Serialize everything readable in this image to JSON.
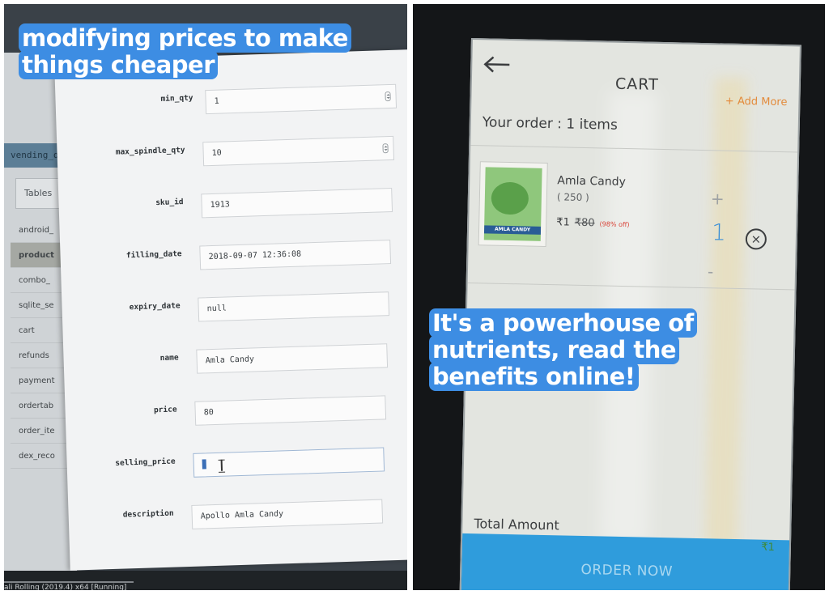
{
  "left_panel": {
    "sidebar": {
      "db_name": "vending_db",
      "tables_button": "Tables",
      "tables": [
        "android_",
        "product",
        "combo_",
        "sqlite_se",
        "cart",
        "refunds",
        "payment",
        "ordertab",
        "order_ite",
        "dex_reco"
      ],
      "active_table": "product"
    },
    "form": {
      "fields": [
        {
          "label": "min_qty",
          "value": "1",
          "spinner": true
        },
        {
          "label": "max_spindle_qty",
          "value": "10",
          "spinner": true
        },
        {
          "label": "sku_id",
          "value": "1913"
        },
        {
          "label": "filling_date",
          "value": "2018-09-07 12:36:08"
        },
        {
          "label": "expiry_date",
          "value": "null"
        },
        {
          "label": "name",
          "value": "Amla Candy"
        },
        {
          "label": "price",
          "value": "80"
        },
        {
          "label": "selling_price",
          "value": "",
          "editing": true
        },
        {
          "label": "description",
          "value": "Apollo Amla Candy"
        }
      ]
    },
    "taskbar_text": "ali Rolling (2019.4) x64 [Running]",
    "caption": "modifying prices to make things cheaper"
  },
  "right_panel": {
    "header": {
      "title": "CART",
      "add_more": "+ Add More"
    },
    "order_summary": "Your order : 1 items",
    "item": {
      "image_label": "AMLA CANDY",
      "name": "Amla Candy",
      "pack": "( 250 )",
      "price": "₹1",
      "original_price": "₹80",
      "discount": "(98% off)",
      "quantity": "1",
      "plus": "+",
      "minus": "-",
      "remove": "×"
    },
    "caption": "It's a powerhouse of nutrients, read the benefits online!",
    "total_label": "Total Amount",
    "total_value": "₹1",
    "order_button": "ORDER NOW"
  },
  "colors": {
    "caption_highlight": "#3d8de3",
    "order_button": "#2f9cdc",
    "add_more": "#e38a3a",
    "discount": "#d9453a",
    "quantity": "#3a8fd8"
  }
}
